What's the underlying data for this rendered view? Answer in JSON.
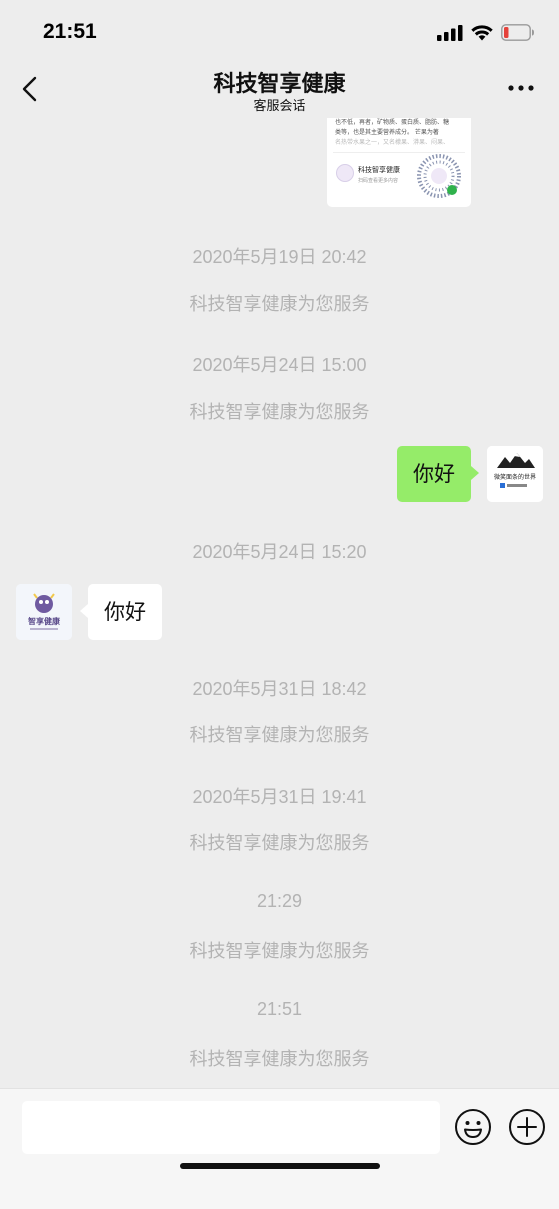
{
  "status_bar": {
    "time": "21:51",
    "icons": [
      "signal-icon",
      "wifi-icon",
      "battery-low-icon"
    ]
  },
  "nav": {
    "title": "科技智享健康",
    "subtitle": "客服会话",
    "icons": [
      "back-chevron-icon",
      "more-dots-icon"
    ]
  },
  "mini_card": {
    "text_line1": "也不低，再者，矿物质、蛋白质、脂肪、糖",
    "text_line2": "类等，也是其主要营养成分。   芒果为著",
    "text_line3": "名热带水果之一，又名檬果、漭果、闷果、",
    "name": "科技智享健康",
    "sub": "扫码查看更多内容"
  },
  "messages": [
    {
      "type": "timestamp",
      "text": "2020年5月19日 20:42"
    },
    {
      "type": "system",
      "text": "科技智享健康为您服务"
    },
    {
      "type": "timestamp",
      "text": "2020年5月24日 15:00"
    },
    {
      "type": "system",
      "text": "科技智享健康为您服务"
    },
    {
      "type": "outgoing",
      "text": "你好"
    },
    {
      "type": "timestamp",
      "text": "2020年5月24日 15:20"
    },
    {
      "type": "incoming",
      "text": "你好"
    },
    {
      "type": "timestamp",
      "text": "2020年5月31日 18:42"
    },
    {
      "type": "system",
      "text": "科技智享健康为您服务"
    },
    {
      "type": "timestamp",
      "text": "2020年5月31日 19:41"
    },
    {
      "type": "system",
      "text": "科技智享健康为您服务"
    },
    {
      "type": "timestamp",
      "text": "21:29"
    },
    {
      "type": "system",
      "text": "科技智享健康为您服务"
    },
    {
      "type": "timestamp",
      "text": "21:51"
    },
    {
      "type": "system",
      "text": "科技智享健康为您服务"
    }
  ],
  "user_avatar": {
    "caption": "微笑面条的世界"
  },
  "service_avatar": {
    "caption": "智享健康"
  },
  "input": {
    "value": "",
    "placeholder": "",
    "icons": [
      "emoji-icon",
      "plus-icon"
    ]
  },
  "colors": {
    "background": "#ededed",
    "outgoing_bubble": "#95ec69",
    "incoming_bubble": "#ffffff",
    "timestamp_text": "#b3b3b3",
    "battery_low": "#e5423b"
  }
}
